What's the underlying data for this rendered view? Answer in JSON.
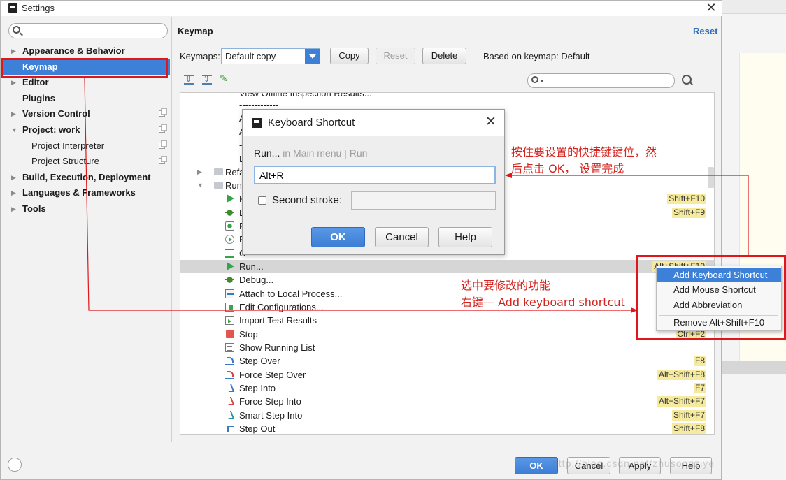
{
  "window": {
    "title": "Settings"
  },
  "sidebar": {
    "search_placeholder": "",
    "items": [
      {
        "label": "Appearance & Behavior",
        "expanded": false
      },
      {
        "label": "Keymap",
        "selected": true
      },
      {
        "label": "Editor",
        "expanded": false
      },
      {
        "label": "Plugins"
      },
      {
        "label": "Version Control",
        "expanded": false
      },
      {
        "label": "Project: work",
        "expanded": true
      },
      {
        "label": "Project Interpreter"
      },
      {
        "label": "Project Structure"
      },
      {
        "label": "Build, Execution, Deployment",
        "expanded": false
      },
      {
        "label": "Languages & Frameworks",
        "expanded": false
      },
      {
        "label": "Tools",
        "expanded": false
      }
    ]
  },
  "main": {
    "title": "Keymap",
    "reset_link": "Reset",
    "keymaps_label": "Keymaps:",
    "keymap_selected": "Default copy",
    "copy_button": "Copy",
    "reset_button": "Reset",
    "delete_button": "Delete",
    "based_on": "Based on keymap: Default",
    "filter_placeholder": ""
  },
  "tree": {
    "rows": [
      {
        "label": "View Offline Inspection Results...",
        "shortcut": ""
      },
      {
        "label": "-------------",
        "shortcut": ""
      },
      {
        "label": "A",
        "shortcut": ""
      },
      {
        "label": "A",
        "shortcut": ""
      },
      {
        "label": "--",
        "shortcut": ""
      },
      {
        "label": "Lo",
        "shortcut": ""
      },
      {
        "label": "Refa",
        "shortcut": ""
      },
      {
        "label": "Run",
        "shortcut": ""
      },
      {
        "label": "R",
        "shortcut": "Shift+F10"
      },
      {
        "label": "D",
        "shortcut": "Shift+F9"
      },
      {
        "label": "R",
        "shortcut": ""
      },
      {
        "label": "P",
        "shortcut": ""
      },
      {
        "label": "C",
        "shortcut": ""
      },
      {
        "label": "Run...",
        "shortcut": "Alt+Shift+F10"
      },
      {
        "label": "Debug...",
        "shortcut": ""
      },
      {
        "label": "Attach to Local Process...",
        "shortcut": ""
      },
      {
        "label": "Edit Configurations...",
        "shortcut": ""
      },
      {
        "label": "Import Test Results",
        "shortcut": ""
      },
      {
        "label": "Stop",
        "shortcut": "Ctrl+F2"
      },
      {
        "label": "Show Running List",
        "shortcut": ""
      },
      {
        "label": "Step Over",
        "shortcut": "F8"
      },
      {
        "label": "Force Step Over",
        "shortcut": "Alt+Shift+F8"
      },
      {
        "label": "Step Into",
        "shortcut": "F7"
      },
      {
        "label": "Force Step Into",
        "shortcut": "Alt+Shift+F7"
      },
      {
        "label": "Smart Step Into",
        "shortcut": "Shift+F7"
      },
      {
        "label": "Step Out",
        "shortcut": "Shift+F8"
      }
    ]
  },
  "dialog": {
    "title": "Keyboard Shortcut",
    "action_name": "Run...",
    "action_context": " in Main menu | Run",
    "first_stroke": "Alt+R",
    "second_stroke_label": "Second stroke:",
    "second_stroke_value": "",
    "ok": "OK",
    "cancel": "Cancel",
    "help": "Help"
  },
  "context_menu": {
    "items": [
      "Add Keyboard Shortcut",
      "Add Mouse Shortcut",
      "Add Abbreviation",
      "Remove Alt+Shift+F10"
    ]
  },
  "footer": {
    "ok": "OK",
    "cancel": "Cancel",
    "apply": "Apply",
    "help": "Help"
  },
  "annotations": {
    "dialog_note_line1": "按住要设置的快捷键键位，然",
    "dialog_note_line2": "后点击 OK，  设置完成",
    "menu_note_line1": "选中要修改的功能",
    "menu_note_line2": "右键— Add keyboard shortcut"
  },
  "watermark": "http://blog.csdn.net/zhusongziye",
  "colors": {
    "accent": "#3d80d8",
    "annotation": "#d4231e",
    "shortcut_badge": "#f5ea9e"
  }
}
